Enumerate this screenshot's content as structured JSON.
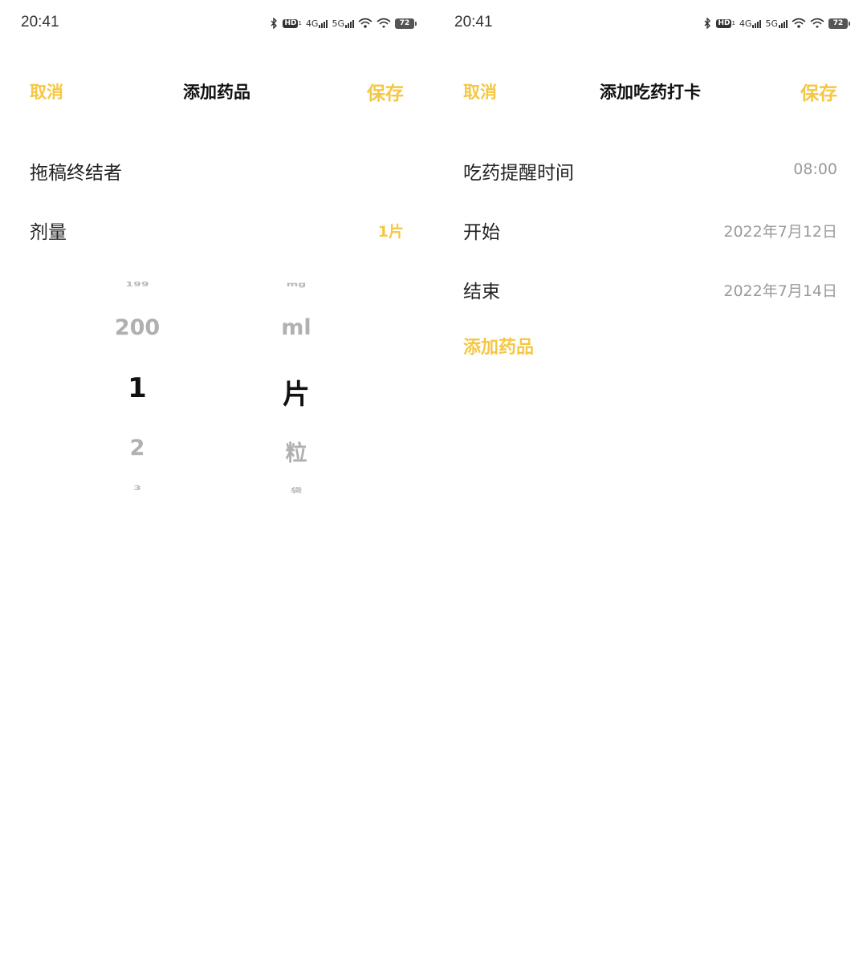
{
  "left_screen": {
    "status": {
      "time": "20:41",
      "battery": "72",
      "network_4g": "4G",
      "network_5g": "5G",
      "hd": "HD"
    },
    "nav": {
      "cancel": "取消",
      "title": "添加药品",
      "save": "保存"
    },
    "medicine_name": "拖稿终结者",
    "dosage": {
      "label": "剂量",
      "value": "1片"
    },
    "picker": {
      "numbers": [
        "199",
        "200",
        "1",
        "2",
        "3"
      ],
      "units": [
        "mg",
        "ml",
        "片",
        "粒",
        "袋"
      ]
    }
  },
  "right_screen": {
    "status": {
      "time": "20:41",
      "battery": "72",
      "network_4g": "4G",
      "network_5g": "5G",
      "hd": "HD"
    },
    "nav": {
      "cancel": "取消",
      "title": "添加吃药打卡",
      "save": "保存"
    },
    "reminder": {
      "label": "吃药提醒时间",
      "value": "08:00"
    },
    "start": {
      "label": "开始",
      "value": "2022年7月12日"
    },
    "end": {
      "label": "结束",
      "value": "2022年7月14日"
    },
    "add_medicine": "添加药品"
  },
  "colors": {
    "accent": "#f5c742",
    "muted": "#9a9a9a",
    "text": "#222222"
  }
}
